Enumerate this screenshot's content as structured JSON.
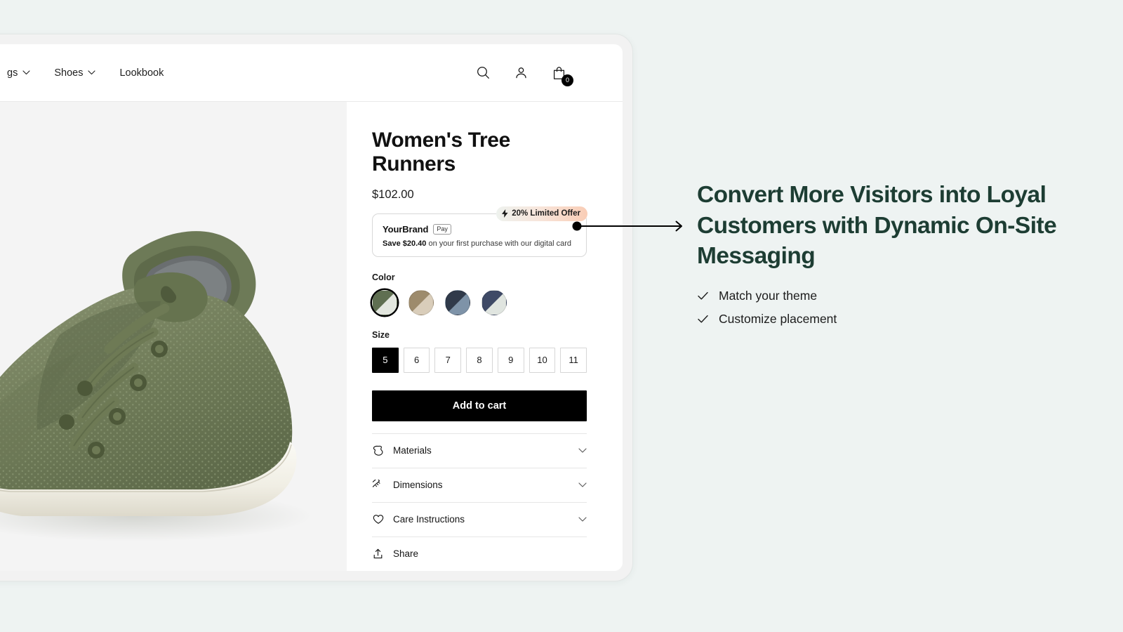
{
  "page": {
    "background_color": "#eef3f2"
  },
  "storefront": {
    "nav": {
      "items": [
        {
          "label": "gs",
          "has_dropdown": true,
          "truncated": true
        },
        {
          "label": "Shoes",
          "has_dropdown": true,
          "truncated": false
        },
        {
          "label": "Lookbook",
          "has_dropdown": false,
          "truncated": false
        }
      ],
      "actions": [
        {
          "icon": "search-icon",
          "label": "Search"
        },
        {
          "icon": "user-icon",
          "label": "Account"
        },
        {
          "icon": "shopping-bag-icon",
          "label": "Cart",
          "badge": "0"
        }
      ]
    },
    "product": {
      "title": "Women's Tree Runners",
      "price": "$102.00",
      "offer": {
        "badge_text": "20% Limited Offer",
        "badge_icon": "lightning-bolt-icon",
        "brand": "YourBrand",
        "pay_chip": "Pay",
        "save_amount": "Save $20.40",
        "save_rest": " on your first purchase with our digital card",
        "badge_gradient_start": "#eef2ee",
        "badge_gradient_end": "#f9cdb6"
      },
      "color": {
        "label": "Color",
        "swatches": [
          {
            "name": "Olive Green",
            "top_color": "#5f6f51",
            "bottom_color": "#e3e7df",
            "selected": true
          },
          {
            "name": "Sand Taupe",
            "top_color": "#9d8b6c",
            "bottom_color": "#d9cdba",
            "selected": false
          },
          {
            "name": "Dark Navy Slate",
            "top_color": "#303a4a",
            "bottom_color": "#7e93a8",
            "selected": false
          },
          {
            "name": "Navy Cream",
            "top_color": "#3f4a66",
            "bottom_color": "#e0e5e0",
            "selected": false
          }
        ]
      },
      "size": {
        "label": "Size",
        "options": [
          "5",
          "6",
          "7",
          "8",
          "9",
          "10",
          "11"
        ],
        "selected": "5"
      },
      "add_to_cart_label": "Add to cart",
      "accordion": [
        {
          "label": "Materials",
          "icon": "hide-leather-icon"
        },
        {
          "label": "Dimensions",
          "icon": "ruler-icon"
        },
        {
          "label": "Care Instructions",
          "icon": "heart-icon"
        }
      ],
      "share": {
        "label": "Share",
        "icon": "share-upload-icon"
      }
    }
  },
  "callout": {
    "headline": "Convert More Visitors into Loyal Customers with Dynamic On-Site Messaging",
    "headline_color": "#1d3d33",
    "bullets": [
      {
        "text": "Match your theme",
        "icon": "check-icon"
      },
      {
        "text": "Customize placement",
        "icon": "check-icon"
      }
    ],
    "connector": {
      "type": "arrow-annotation",
      "dot_color": "#000000",
      "line_color": "#000000"
    }
  }
}
